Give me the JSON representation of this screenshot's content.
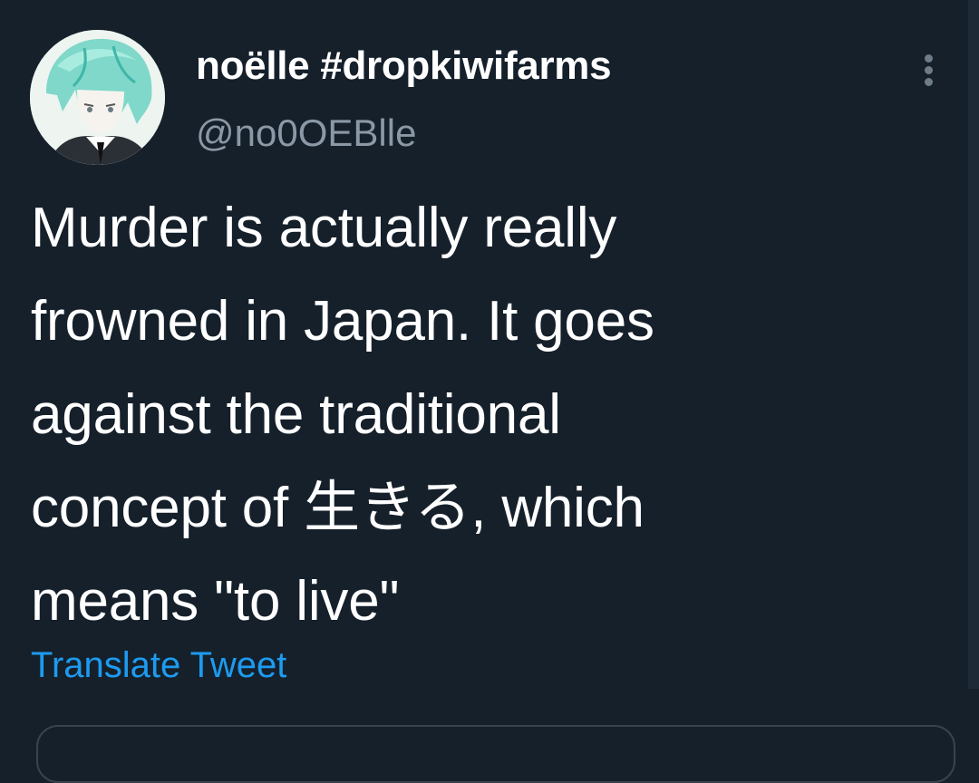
{
  "user": {
    "display_name": "noëlle #dropkiwifarms",
    "handle": "@no0OEBlle"
  },
  "tweet": {
    "text_lines": [
      "Murder is actually really",
      "frowned in Japan. It goes",
      "against the traditional",
      "concept of 生きる, which",
      "means \"to live\""
    ],
    "translate_label": "Translate Tweet"
  },
  "icons": {
    "more": "more-vertical-icon"
  },
  "colors": {
    "background": "#15202b",
    "text": "#ffffff",
    "secondary_text": "#8b98a5",
    "link": "#1d9bf0"
  }
}
